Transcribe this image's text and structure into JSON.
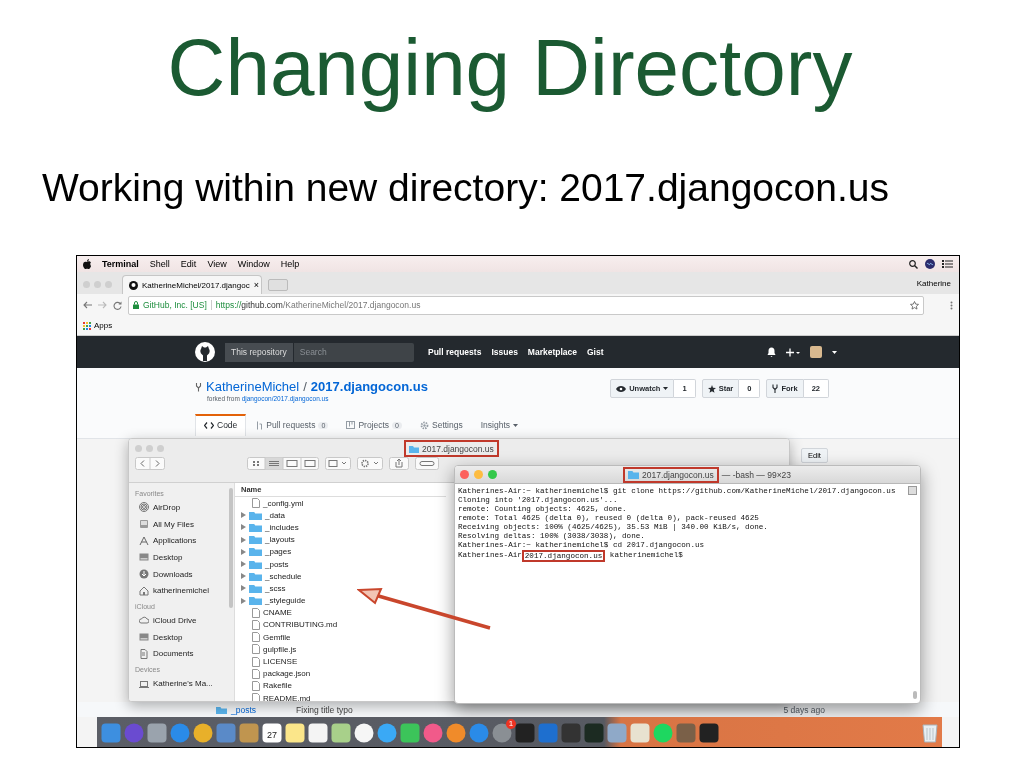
{
  "slide": {
    "title": "Changing Directory",
    "subtitle": "Working within new directory: 2017.djangocon.us"
  },
  "menu_bar": {
    "app": "Terminal",
    "items": [
      "Shell",
      "Edit",
      "View",
      "Window",
      "Help"
    ]
  },
  "browser": {
    "tab": {
      "title": "KatherineMichel/2017.djangoc",
      "close": "×"
    },
    "profile": "Katherine",
    "address": {
      "site": "GitHub, Inc. [US]",
      "scheme": "https://",
      "domain": "github.com",
      "path": "/KatherineMichel/2017.djangocon.us"
    },
    "bookmarks": [
      "Apps"
    ]
  },
  "github": {
    "scope": "This repository",
    "search_placeholder": "Search",
    "nav": [
      "Pull requests",
      "Issues",
      "Marketplace",
      "Gist"
    ],
    "owner": "KatherineMichel",
    "separator": "/",
    "repo": "2017.djangocon.us",
    "forked_prefix": "forked from",
    "forked_link": "djangocon/2017.djangocon.us",
    "actions": [
      {
        "kind": "watch",
        "label": "Unwatch",
        "count": "1"
      },
      {
        "kind": "star",
        "label": "Star",
        "count": "0"
      },
      {
        "kind": "fork",
        "label": "Fork",
        "count": "22"
      }
    ],
    "tabs": [
      {
        "kind": "code",
        "label": "Code",
        "selected": true
      },
      {
        "kind": "pulls",
        "label": "Pull requests",
        "count": "0",
        "selected": false
      },
      {
        "kind": "projects",
        "label": "Projects",
        "count": "0",
        "selected": false
      },
      {
        "kind": "settings",
        "label": "Settings",
        "selected": false
      },
      {
        "kind": "insights",
        "label": "Insights",
        "selected": false
      }
    ],
    "edit_button": "Edit",
    "commit_row": {
      "name": "_posts",
      "message": "Fixing title typo",
      "age": "5 days ago"
    }
  },
  "finder": {
    "title": "2017.djangocon.us",
    "column": "Name",
    "sidebar": [
      {
        "heading": "Favorites",
        "items": [
          {
            "kind": "airdrop",
            "label": "AirDrop"
          },
          {
            "kind": "files",
            "label": "All My Files"
          },
          {
            "kind": "apps",
            "label": "Applications"
          },
          {
            "kind": "desktop",
            "label": "Desktop"
          },
          {
            "kind": "downloads",
            "label": "Downloads"
          },
          {
            "kind": "home",
            "label": "katherinemichel"
          }
        ]
      },
      {
        "heading": "iCloud",
        "items": [
          {
            "kind": "cloud",
            "label": "iCloud Drive"
          },
          {
            "kind": "desktop",
            "label": "Desktop"
          },
          {
            "kind": "documents",
            "label": "Documents"
          }
        ]
      },
      {
        "heading": "Devices",
        "items": [
          {
            "kind": "laptop",
            "label": "Katherine's Ma..."
          }
        ]
      }
    ],
    "files": [
      {
        "kind": "file",
        "name": "_config.yml"
      },
      {
        "kind": "folder",
        "name": "_data"
      },
      {
        "kind": "folder",
        "name": "_includes"
      },
      {
        "kind": "folder",
        "name": "_layouts"
      },
      {
        "kind": "folder",
        "name": "_pages"
      },
      {
        "kind": "folder",
        "name": "_posts"
      },
      {
        "kind": "folder",
        "name": "_schedule"
      },
      {
        "kind": "folder",
        "name": "_scss"
      },
      {
        "kind": "folder",
        "name": "_styleguide"
      },
      {
        "kind": "file",
        "name": "CNAME"
      },
      {
        "kind": "file",
        "name": "CONTRIBUTING.md"
      },
      {
        "kind": "file",
        "name": "Gemfile"
      },
      {
        "kind": "file",
        "name": "gulpfile.js"
      },
      {
        "kind": "file",
        "name": "LICENSE"
      },
      {
        "kind": "file",
        "name": "package.json"
      },
      {
        "kind": "file",
        "name": "Rakefile"
      },
      {
        "kind": "file",
        "name": "README.md"
      }
    ]
  },
  "terminal": {
    "title_dir": "2017.djangocon.us",
    "title_rest": "— -bash — 99×23",
    "lines": [
      "Katherines-Air:~ katherinemichel$ git clone https://github.com/KatherineMichel/2017.djangocon.us",
      "Cloning into '2017.djangocon.us'...",
      "remote: Counting objects: 4625, done.",
      "remote: Total 4625 (delta 0), reused 0 (delta 0), pack-reused 4625",
      "Receiving objects: 100% (4625/4625), 35.53 MiB | 340.00 KiB/s, done.",
      "Resolving deltas: 100% (3038/3038), done.",
      "Katherines-Air:~ katherinemichel$ cd 2017.djangocon.us"
    ],
    "prompt": {
      "host": "Katherines-Air",
      "dir": "2017.djangocon.us",
      "user": " katherinemichel$"
    }
  },
  "dock": {
    "calendar_date": "27",
    "badge": "1"
  }
}
